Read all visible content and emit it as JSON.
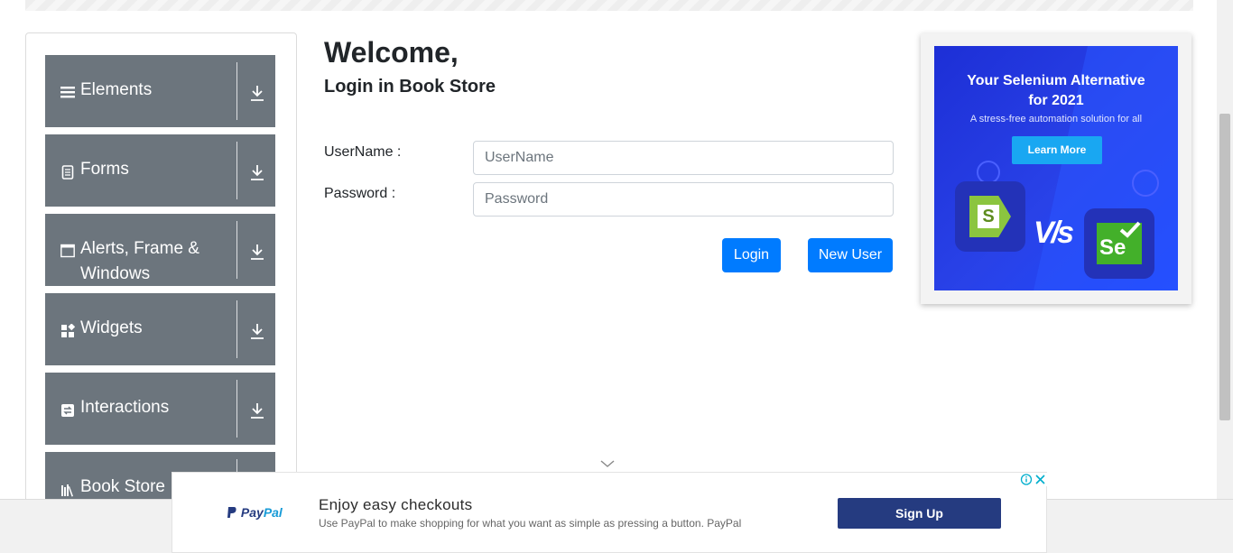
{
  "sidebar": {
    "groups": [
      {
        "label": "Elements",
        "icon": "list-icon"
      },
      {
        "label": "Forms",
        "icon": "document-icon"
      },
      {
        "label": "Alerts, Frame & Windows",
        "icon": "window-icon"
      },
      {
        "label": "Widgets",
        "icon": "widgets-icon"
      },
      {
        "label": "Interactions",
        "icon": "interactions-icon"
      },
      {
        "label": "Book Store",
        "icon": "books-icon"
      }
    ]
  },
  "main": {
    "title": "Welcome,",
    "subtitle": "Login in Book Store",
    "username_label": "UserName :",
    "username_value": "",
    "username_placeholder": "UserName",
    "password_label": "Password :",
    "password_value": "",
    "password_placeholder": "Password",
    "login_button": "Login",
    "new_user_button": "New User"
  },
  "side_ad": {
    "title_line1": "Your Selenium Alternative",
    "title_line2": "for 2021",
    "subtitle": "A stress-free automation solution for all",
    "button": "Learn More",
    "vs_text": "V/s",
    "logo_left": "S",
    "logo_right": "Se"
  },
  "bottom_ad": {
    "logo_pay": "Pay",
    "logo_pal": "Pal",
    "headline": "Enjoy easy checkouts",
    "description": "Use PayPal to make shopping for what you want as simple as pressing a button. PayPal",
    "button": "Sign Up"
  },
  "colors": {
    "primary": "#007bff",
    "sidebar_group": "#6c757d",
    "paypal_blue": "#253b80",
    "paypal_light": "#179bd7",
    "ad_bg": "#2942e8"
  }
}
